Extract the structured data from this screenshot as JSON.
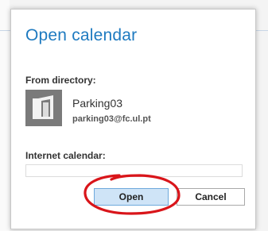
{
  "dialog": {
    "title": "Open calendar",
    "from_directory_label": "From directory:",
    "entry": {
      "name": "Parking03",
      "email": "parking03@fc.ul.pt",
      "avatar_icon": "generic-resource-icon"
    },
    "internet_calendar_label": "Internet calendar:",
    "internet_calendar_value": "",
    "buttons": {
      "open_label": "Open",
      "cancel_label": "Cancel"
    }
  },
  "colors": {
    "title": "#1e7ac0",
    "open_button_fill": "#cfe4f7",
    "open_button_border": "#6ea9dc",
    "annotation_circle": "#d9151a",
    "avatar_background": "#7a7a7a"
  }
}
